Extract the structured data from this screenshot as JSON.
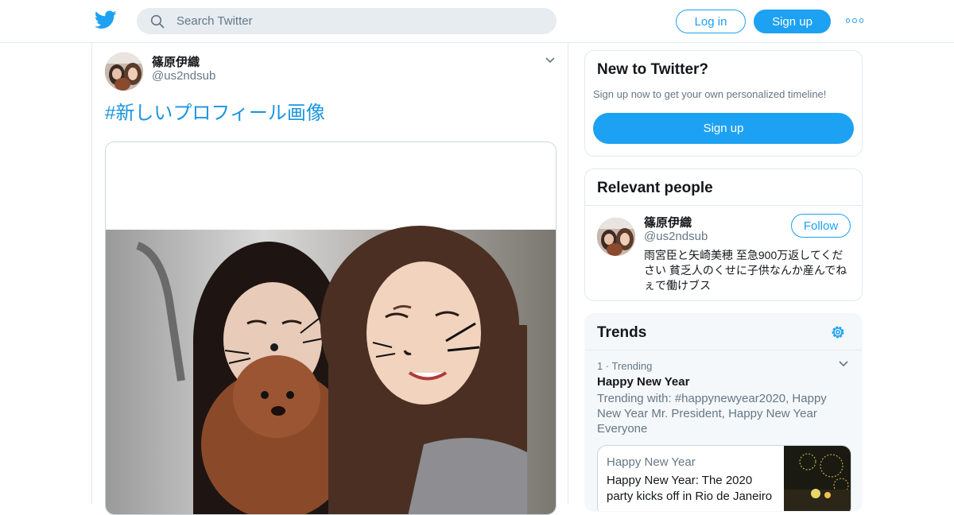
{
  "header": {
    "logo_icon": "twitter-bird-icon",
    "search": {
      "placeholder": "Search Twitter",
      "icon": "search-icon"
    },
    "login_label": "Log in",
    "signup_label": "Sign up",
    "more_icon": "more-icon"
  },
  "tweet": {
    "display_name": "篠原伊織",
    "handle": "@us2ndsub",
    "text": "#新しいプロフィール画像",
    "menu_icon": "chevron-down-icon"
  },
  "new_to_twitter": {
    "title": "New to Twitter?",
    "subtitle": "Sign up now to get your own personalized timeline!",
    "button_label": "Sign up"
  },
  "relevant_people": {
    "title": "Relevant people",
    "person": {
      "name": "篠原伊織",
      "handle": "@us2ndsub",
      "follow_label": "Follow",
      "bio": "雨宮臣と矢崎美穂 至急900万返してください 貧乏人のくせに子供なんか産んでねぇで働けブス"
    }
  },
  "trends": {
    "title": "Trends",
    "settings_icon": "gear-icon",
    "items": [
      {
        "meta": "1 · Trending",
        "name": "Happy New Year",
        "trending_with": "Trending with: #happynewyear2020, Happy New Year Mr. President, Happy New Year Everyone",
        "news": {
          "source": "Happy New Year",
          "title": "Happy New Year: The 2020 party kicks off in Rio de Janeiro"
        }
      }
    ]
  },
  "colors": {
    "brand": "#1da1f2",
    "link": "#1b95e0",
    "secondary_text": "#657786",
    "border": "#e1e8ed"
  }
}
